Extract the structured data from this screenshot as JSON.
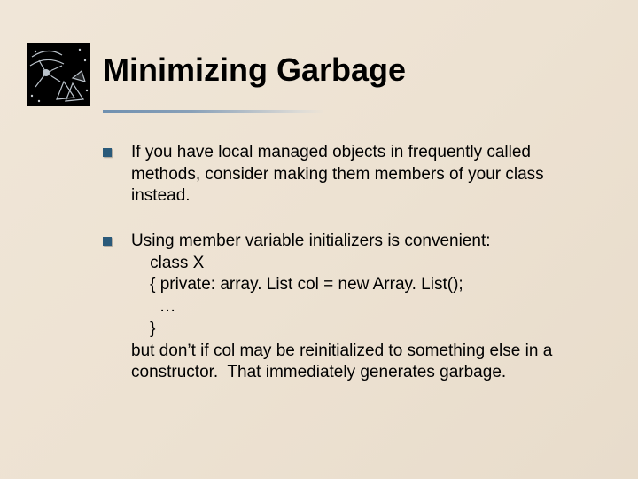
{
  "slide": {
    "title": "Minimizing Garbage",
    "bullets": [
      {
        "text": "If you have local managed objects in frequently called methods, consider making them members of your class instead."
      },
      {
        "lines": [
          "Using member variable initializers is convenient:",
          "    class X",
          "    { private: array. List col = new Array. List();",
          "      …",
          "    }",
          "but don’t if col may be reinitialized to something else in a constructor.  That immediately generates garbage."
        ]
      }
    ]
  }
}
